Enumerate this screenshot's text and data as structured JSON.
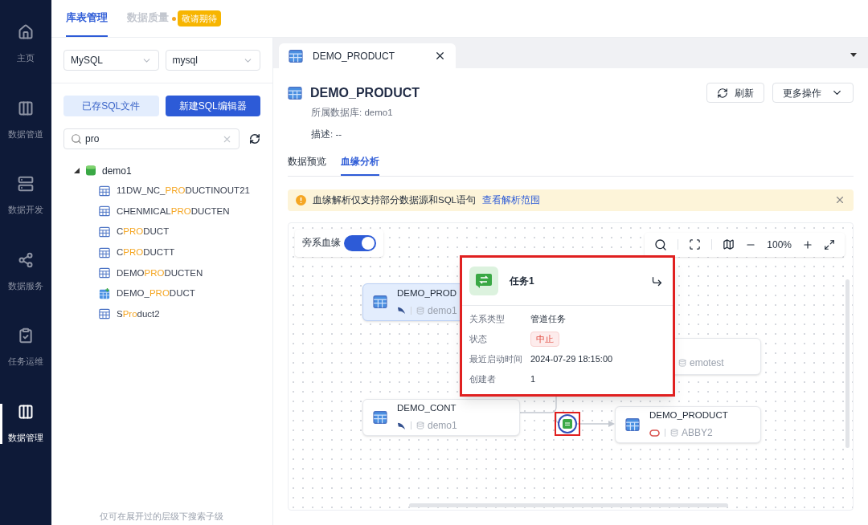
{
  "sidebar": {
    "items": [
      {
        "label": "主页",
        "selected": false
      },
      {
        "label": "数据管道",
        "selected": false
      },
      {
        "label": "数据开发",
        "selected": false
      },
      {
        "label": "数据服务",
        "selected": false
      },
      {
        "label": "任务运维",
        "selected": false
      },
      {
        "label": "数据管理",
        "selected": true
      }
    ]
  },
  "top_tabs": [
    {
      "label": "库表管理",
      "selected": true,
      "disabled": false
    },
    {
      "label": "数据质量",
      "selected": false,
      "disabled": true,
      "badge": "敬请期待"
    }
  ],
  "left_panel": {
    "db_type": "MySQL",
    "db_name": "mysql",
    "saved_button": "已存SQL文件",
    "new_button": "新建SQL编辑器",
    "search": {
      "value": "pro"
    },
    "tree": [
      {
        "label": "demo1",
        "expanded": true,
        "children": [
          {
            "parts": [
              "11DW_NC_",
              "PRO",
              "DUCTINOUT21"
            ],
            "kind": "table"
          },
          {
            "parts": [
              "CHENMICAL",
              "PRO",
              "DUCTEN"
            ],
            "kind": "table"
          },
          {
            "parts": [
              "C",
              "PRO",
              "DUCT"
            ],
            "kind": "table"
          },
          {
            "parts": [
              "C",
              "PRO",
              "DUCTT"
            ],
            "kind": "table"
          },
          {
            "parts": [
              "DEMO",
              "PRO",
              "DUCTEN"
            ],
            "kind": "table"
          },
          {
            "parts": [
              "DEMO_",
              "PRO",
              "DUCT"
            ],
            "kind": "current"
          },
          {
            "parts": [
              "S",
              "Pro",
              "duct2"
            ],
            "kind": "table"
          }
        ]
      }
    ],
    "hint": "仅可在展开过的层级下搜索子级"
  },
  "editor_tabs": [
    {
      "label": "DEMO_PRODUCT",
      "selected": true
    }
  ],
  "detail": {
    "title": "DEMO_PRODUCT",
    "refresh_button": "刷新",
    "more_button": "更多操作",
    "database": "所属数据库: demo1",
    "description": "描述: --",
    "tabs": [
      {
        "label": "数据预览",
        "selected": false
      },
      {
        "label": "血缘分析",
        "selected": true
      }
    ],
    "alert": {
      "text": "血缘解析仅支持部分数据源和SQL语句",
      "link": "查看解析范围"
    }
  },
  "lineage": {
    "side_lineage": {
      "label": "旁系血缘",
      "on": true
    },
    "zoom": "100%",
    "nodes": [
      {
        "name": "DEMO_PROD",
        "source": "demo1",
        "kind": "mysql",
        "selected": true
      },
      {
        "source": "emotest",
        "kind": "hidden",
        "selected": false
      },
      {
        "name": "DEMO_CONT",
        "source": "demo1",
        "kind": "mysql",
        "selected": false
      },
      {
        "name": "DEMO_PRODUCT",
        "source": "ABBY2",
        "kind": "oracle",
        "selected": false
      }
    ],
    "task_node": {
      "highlighted": true
    },
    "popover": {
      "title": "任务1",
      "highlighted": true,
      "fields": [
        {
          "label": "关系类型",
          "value": "管道任务",
          "kind": "text"
        },
        {
          "label": "状态",
          "value": "中止",
          "kind": "tag"
        },
        {
          "label": "最近启动时间",
          "value": "2024-07-29 18:15:00",
          "kind": "text"
        },
        {
          "label": "创建者",
          "value": "1",
          "kind": "text"
        }
      ]
    }
  }
}
